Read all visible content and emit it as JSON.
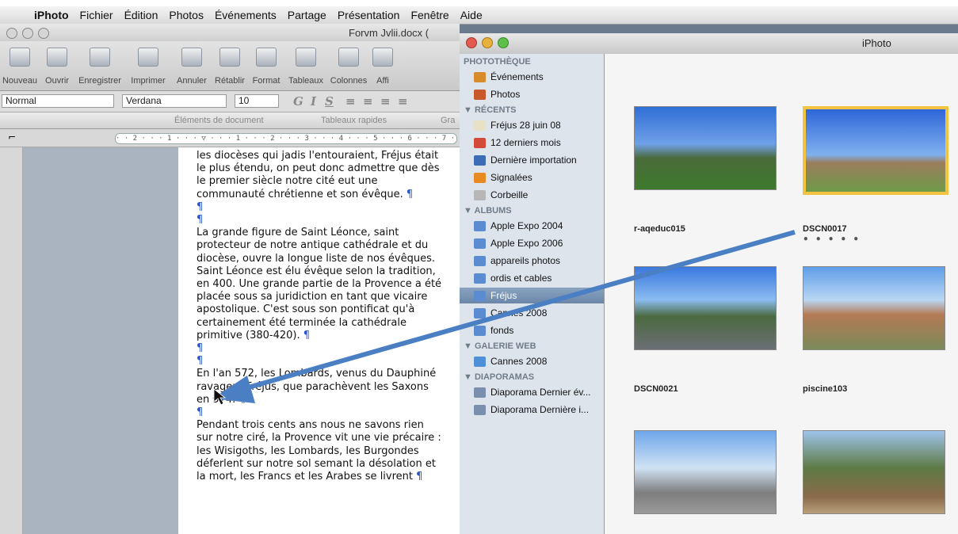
{
  "menubar": {
    "app": "iPhoto",
    "items": [
      "Fichier",
      "Édition",
      "Photos",
      "Événements",
      "Partage",
      "Présentation",
      "Fenêtre",
      "Aide"
    ]
  },
  "word": {
    "title": "Forvm Jvlii.docx (",
    "toolbar": [
      "Nouveau",
      "Ouvrir",
      "Enregistrer",
      "Imprimer",
      "Annuler",
      "Rétablir",
      "Format",
      "Tableaux",
      "Colonnes",
      "Affi"
    ],
    "style": "Normal",
    "font": "Verdana",
    "size": "10",
    "gallery_tabs": [
      "Éléments de document",
      "Tableaux rapides",
      "Gra"
    ],
    "ruler": "· · 2 · · · 1 · · · ▽ · · · 1 · · · 2 · · · 3 · · · 4 · · · 5 · · · 6 · · · 7 · △",
    "paragraphs": [
      "les diocèses qui jadis l'entouraient, Fréjus était le plus étendu, on peut donc admettre que dès le premier siècle notre cité eut une communauté chrétienne et son évêque.",
      "",
      "",
      "La grande figure de Saint Léonce, saint protecteur de notre antique cathédrale et du diocèse, ouvre la longue liste de nos évêques. Saint Léonce est élu évêque selon la tradition, en 400. Une grande partie de la Provence a été placée sous sa juridiction en tant que vicaire apostolique. C'est sous son pontificat qu'à certainement été terminée la cathédrale primitive (380-420).",
      "",
      "",
      "En l'an 572, les Lombards, venus du Dauphiné ravagent Fréjus, que parachèvent les Saxons en 574.",
      "",
      "Pendant trois cents ans nous ne savons rien sur notre ciré, la Provence vit une vie précaire : les Wisigoths, les Lombards, les Burgondes déferlent sur notre sol semant la désolation et la mort, les Francs et les Arabes se livrent"
    ],
    "pilcrow": "¶"
  },
  "iphoto": {
    "title": "iPhoto",
    "sections": [
      {
        "label": "PHOTOTHÈQUE",
        "items": [
          {
            "label": "Événements",
            "icon": "events-icon",
            "color": "#d98a2b"
          },
          {
            "label": "Photos",
            "icon": "photos-icon",
            "color": "#c9572c"
          }
        ]
      },
      {
        "label": "▼ RÉCENTS",
        "items": [
          {
            "label": "Fréjus 28 juin 08",
            "icon": "event-icon",
            "color": "#e9e0c8"
          },
          {
            "label": "12 derniers mois",
            "icon": "calendar-icon",
            "color": "#d44a3a"
          },
          {
            "label": "Dernière importation",
            "icon": "import-icon",
            "color": "#3d6cb7"
          },
          {
            "label": "Signalées",
            "icon": "flag-icon",
            "color": "#e78a22"
          },
          {
            "label": "Corbeille",
            "icon": "trash-icon",
            "color": "#b7b7b7"
          }
        ]
      },
      {
        "label": "▼ ALBUMS",
        "items": [
          {
            "label": "Apple Expo 2004",
            "icon": "album-icon",
            "color": "#5b8bd0"
          },
          {
            "label": "Apple Expo 2006",
            "icon": "album-icon",
            "color": "#5b8bd0"
          },
          {
            "label": "appareils photos",
            "icon": "album-icon",
            "color": "#5b8bd0"
          },
          {
            "label": "ordis et cables",
            "icon": "album-icon",
            "color": "#5b8bd0"
          },
          {
            "label": "Fréjus",
            "icon": "album-icon",
            "color": "#5b8bd0",
            "selected": true
          },
          {
            "label": "Cannes 2008",
            "icon": "album-icon",
            "color": "#5b8bd0"
          },
          {
            "label": "fonds",
            "icon": "album-icon",
            "color": "#5b8bd0"
          }
        ]
      },
      {
        "label": "▼ GALERIE WEB",
        "items": [
          {
            "label": "Cannes 2008",
            "icon": "web-gallery-icon",
            "color": "#4f8fd8"
          }
        ]
      },
      {
        "label": "▼ DIAPORAMAS",
        "items": [
          {
            "label": "Diaporama Dernier év...",
            "icon": "slideshow-icon",
            "color": "#7a8fae"
          },
          {
            "label": "Diaporama Dernière i...",
            "icon": "slideshow-icon",
            "color": "#7a8fae"
          }
        ]
      }
    ],
    "photos": [
      {
        "label": "r-aqeduc015",
        "stars": ""
      },
      {
        "label": "DSCN0017",
        "stars": "• • • • •",
        "selected": true
      },
      {
        "label": "DSCN0021",
        "stars": ""
      },
      {
        "label": "piscine103",
        "stars": ""
      },
      {
        "label": "",
        "stars": ""
      },
      {
        "label": "",
        "stars": ""
      }
    ]
  },
  "colors": {
    "annotation_arrow": "#4a7fc4",
    "selection": "#f2c442",
    "caption": "#e8261a"
  }
}
